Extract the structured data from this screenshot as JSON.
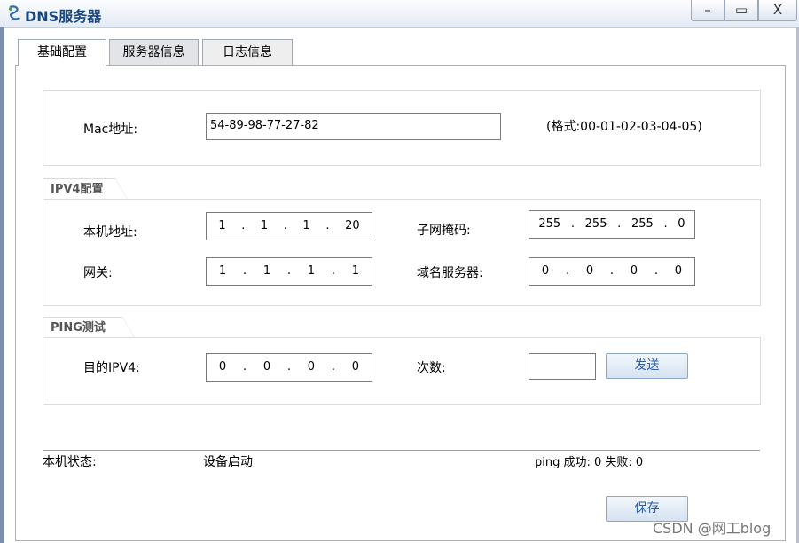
{
  "window": {
    "title": "DNS服务器",
    "min_glyph": "–",
    "max_glyph": "▭",
    "close_glyph": "X"
  },
  "tabs": [
    {
      "label": "基础配置"
    },
    {
      "label": "服务器信息"
    },
    {
      "label": "日志信息"
    }
  ],
  "mac": {
    "label": "Mac地址:",
    "value": "54-89-98-77-27-82",
    "format_hint": "(格式:00-01-02-03-04-05)"
  },
  "ipv4": {
    "legend": "IPV4配置",
    "local_label": "本机地址:",
    "local": [
      "1",
      "1",
      "1",
      "20"
    ],
    "mask_label": "子网掩码:",
    "mask": [
      "255",
      "255",
      "255",
      "0"
    ],
    "gateway_label": "网关:",
    "gateway": [
      "1",
      "1",
      "1",
      "1"
    ],
    "dns_label": "域名服务器:",
    "dns": [
      "0",
      "0",
      "0",
      "0"
    ]
  },
  "ping": {
    "legend": "PING测试",
    "dest_label": "目的IPV4:",
    "dest": [
      "0",
      "0",
      "0",
      "0"
    ],
    "count_label": "次数:",
    "count_value": "",
    "send_label": "发送"
  },
  "status": {
    "label": "本机状态:",
    "value": "设备启动",
    "ping_result": "ping 成功: 0 失败: 0"
  },
  "save_label": "保存",
  "watermark": "CSDN @网工blog",
  "colors": {
    "title": "#18467f",
    "button_text": "#2a5da8",
    "titlebar_top": "#fbfcfe",
    "titlebar_bottom": "#e4ebf4"
  }
}
